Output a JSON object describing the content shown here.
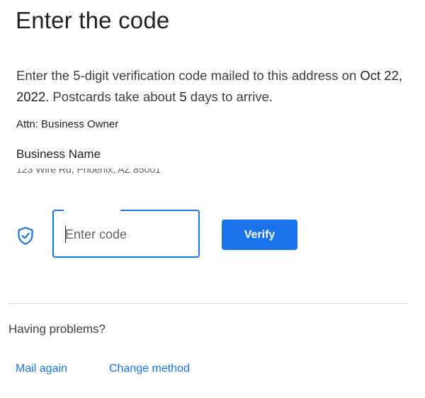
{
  "page": {
    "title": "Enter the code"
  },
  "instructions": {
    "part1": "Enter the 5-digit verification code mailed to this address on ",
    "date": "Oct 22, 2022",
    "part2": ". Postcards take about ",
    "days": "5",
    "part3": " days to arrive."
  },
  "address": {
    "attn": "Attn: Business Owner",
    "business_name": "Business Name",
    "street": "123 Wire Rd, Phoenix, AZ 85001"
  },
  "verify_form": {
    "shield_icon": "verified-shield-icon",
    "code_placeholder": "Enter code",
    "code_value": "",
    "verify_label": "Verify"
  },
  "help": {
    "problems_label": "Having problems?",
    "mail_again_label": "Mail again",
    "change_method_label": "Change method"
  },
  "colors": {
    "accent": "#1a73e8",
    "text": "#202124",
    "divider": "#dadce0"
  }
}
